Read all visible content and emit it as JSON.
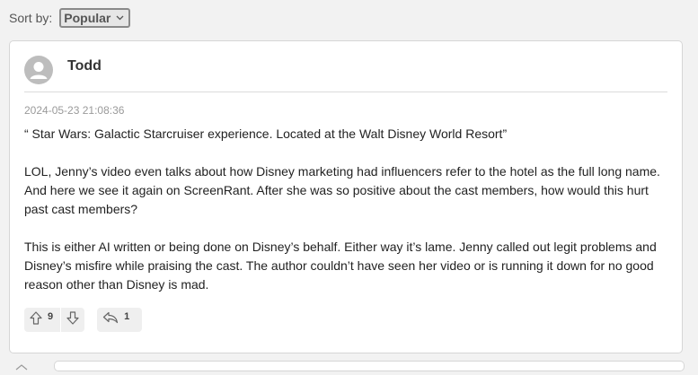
{
  "sort": {
    "label": "Sort by:",
    "selected": "Popular"
  },
  "comment": {
    "author": "Todd",
    "timestamp": "2024-05-23 21:08:36",
    "paragraphs": [
      "“ Star Wars: Galactic Starcruiser experience. Located at the Walt Disney World Resort”",
      "LOL, Jenny’s video even talks about how Disney marketing had influencers refer to the hotel as the full long name. And here we see it again on ScreenRant. After she was so positive about the cast members, how would this hurt past cast members?",
      "This is either AI written or being done on Disney’s behalf. Either way it’s lame. Jenny called out legit problems and Disney’s misfire while praising the cast. The author couldn’t have seen her video or is running it down for no good reason other than Disney is mad."
    ],
    "upvotes": "9",
    "replies": "1"
  },
  "icons": {
    "avatar": "user-avatar-icon",
    "upvote": "arrow-up-icon",
    "downvote": "arrow-down-icon",
    "reply": "reply-icon",
    "chevron": "chevron-down-icon"
  },
  "colors": {
    "background": "#f2f2f2",
    "card": "#ffffff",
    "avatar": "#bdbdbd",
    "muted_text": "#9a9a9a"
  }
}
